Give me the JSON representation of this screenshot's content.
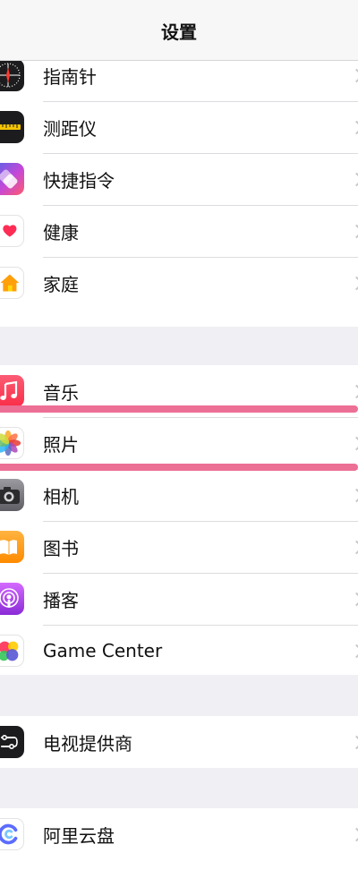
{
  "header": {
    "title": "设置"
  },
  "groups": [
    {
      "items": [
        {
          "label": "指南针",
          "icon": "compass-icon"
        },
        {
          "label": "测距仪",
          "icon": "measure-icon"
        },
        {
          "label": "快捷指令",
          "icon": "shortcuts-icon"
        },
        {
          "label": "健康",
          "icon": "health-icon"
        },
        {
          "label": "家庭",
          "icon": "home-icon"
        }
      ]
    },
    {
      "items": [
        {
          "label": "音乐",
          "icon": "music-icon"
        },
        {
          "label": "照片",
          "icon": "photos-icon"
        },
        {
          "label": "相机",
          "icon": "camera-icon"
        },
        {
          "label": "图书",
          "icon": "books-icon"
        },
        {
          "label": "播客",
          "icon": "podcasts-icon"
        },
        {
          "label": "Game Center",
          "icon": "game-center-icon"
        }
      ]
    },
    {
      "items": [
        {
          "label": "电视提供商",
          "icon": "tv-provider-icon"
        }
      ]
    },
    {
      "items": [
        {
          "label": "阿里云盘",
          "icon": "aliyun-drive-icon"
        }
      ]
    }
  ],
  "highlight": {
    "color": "#ec6f95",
    "target": "照片"
  }
}
